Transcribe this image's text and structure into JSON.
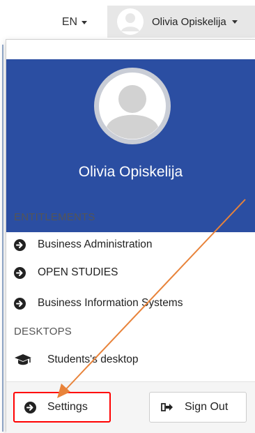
{
  "topbar": {
    "language": "EN",
    "user_name": "Olivia Opiskelija"
  },
  "menu": {
    "header": {
      "full_name": "Olivia Opiskelija"
    },
    "entitlements_label": "ENTITLEMENTS",
    "entitlements": [
      {
        "label": "Business Administration"
      },
      {
        "label": "OPEN STUDIES"
      },
      {
        "label": "Business Information Systems"
      }
    ],
    "desktops_label": "DESKTOPS",
    "desktops": [
      {
        "label": "Students's desktop"
      }
    ],
    "footer": {
      "settings_label": "Settings",
      "signout_label": "Sign Out"
    }
  },
  "colors": {
    "header_bg": "#2b4ea2",
    "highlight_box": "#ff0000",
    "annotation_arrow": "#e8833a"
  }
}
